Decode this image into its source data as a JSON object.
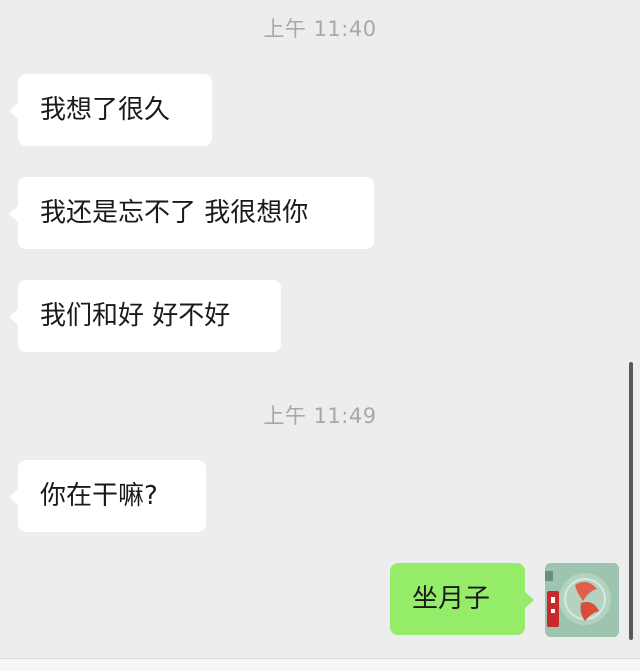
{
  "timestamps": [
    "上午 11:40",
    "上午 11:49"
  ],
  "messages": [
    {
      "side": "left",
      "text": "我想了很久"
    },
    {
      "side": "left",
      "text": "我还是忘不了 我很想你"
    },
    {
      "side": "left",
      "text": "我们和好 好不好"
    },
    {
      "side": "left",
      "text": "你在干嘛?"
    },
    {
      "side": "right",
      "text": "坐月子"
    }
  ],
  "colors": {
    "background": "#ededed",
    "incoming_bubble": "#ffffff",
    "outgoing_bubble": "#95ec69",
    "timestamp_text": "#a8a8a8"
  },
  "icons": {
    "avatar": "user-avatar-image"
  }
}
